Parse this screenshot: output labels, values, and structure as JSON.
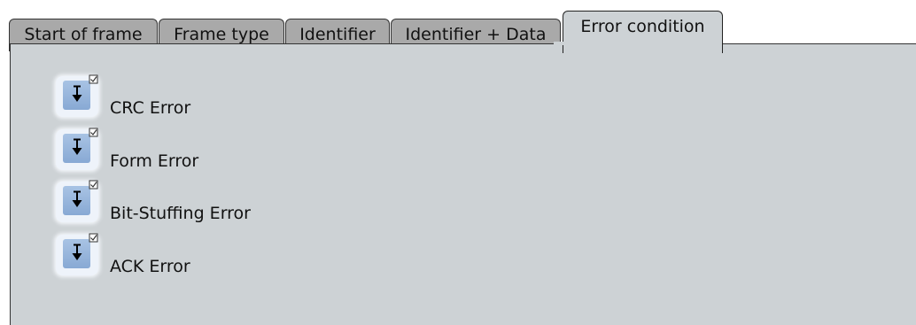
{
  "tabs": [
    {
      "label": "Start of frame",
      "active": false
    },
    {
      "label": "Frame type",
      "active": false
    },
    {
      "label": "Identifier",
      "active": false
    },
    {
      "label": "Identifier + Data",
      "active": false
    },
    {
      "label": "Error condition",
      "active": true
    }
  ],
  "errors": [
    {
      "label": "CRC Error",
      "checked": true
    },
    {
      "label": "Form Error",
      "checked": true
    },
    {
      "label": "Bit-Stuffing Error",
      "checked": true
    },
    {
      "label": "ACK Error",
      "checked": true
    }
  ],
  "icon": "trigger-checkbox-icon"
}
